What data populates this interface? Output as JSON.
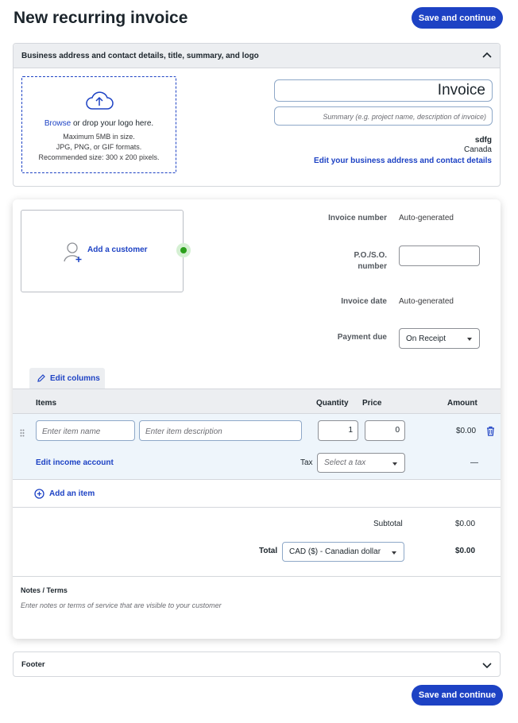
{
  "page": {
    "title": "New recurring invoice"
  },
  "actions": {
    "save_continue": "Save and continue"
  },
  "business_section": {
    "header": "Business address and contact details, title, summary, and logo",
    "logo": {
      "browse": "Browse",
      "drop_text": "or drop your logo here.",
      "line1": "Maximum 5MB in size.",
      "line2": "JPG, PNG, or GIF formats.",
      "line3": "Recommended size: 300 x 200 pixels."
    },
    "title_value": "Invoice",
    "summary_placeholder": "Summary (e.g. project name, description of invoice)",
    "company_name": "sdfg",
    "country": "Canada",
    "edit_link": "Edit your business address and contact details"
  },
  "invoice": {
    "add_customer": "Add a customer",
    "invoice_number_label": "Invoice number",
    "invoice_number_value": "Auto-generated",
    "po_label_1": "P.O./S.O.",
    "po_label_2": "number",
    "invoice_date_label": "Invoice date",
    "invoice_date_value": "Auto-generated",
    "payment_due_label": "Payment due",
    "payment_due_value": "On Receipt",
    "edit_columns": "Edit columns"
  },
  "items_table": {
    "headers": {
      "items": "Items",
      "quantity": "Quantity",
      "price": "Price",
      "amount": "Amount"
    },
    "row": {
      "item_name_placeholder": "Enter item name",
      "item_desc_placeholder": "Enter item description",
      "quantity": "1",
      "price": "0",
      "amount": "$0.00",
      "edit_income": "Edit income account",
      "tax_label": "Tax",
      "tax_placeholder": "Select a tax",
      "tax_amount": "—"
    },
    "add_item": "Add an item"
  },
  "totals": {
    "subtotal_label": "Subtotal",
    "subtotal_value": "$0.00",
    "total_label": "Total",
    "currency": "CAD ($) - Canadian dollar",
    "total_value": "$0.00"
  },
  "notes": {
    "label": "Notes / Terms",
    "placeholder": "Enter notes or terms of service that are visible to your customer"
  },
  "footer": {
    "label": "Footer"
  },
  "colors": {
    "primary": "#1d42c4",
    "header_bg": "#eceef1",
    "row_bg": "#eef5fb",
    "status_green": "#2ca01c"
  }
}
